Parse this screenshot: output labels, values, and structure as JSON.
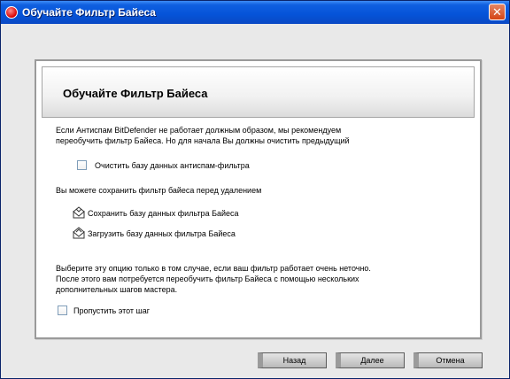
{
  "window": {
    "title": "Обучайте Фильтр Байеса",
    "close_label": "✕"
  },
  "panel": {
    "title": "Обучайте Фильтр Байеса",
    "intro_line1": "Если Антиспам BitDefender не работает должным образом, мы рекомендуем",
    "intro_line2": "переобучить фильтр Байеса. Но для начала Вы должны очистить предыдущий",
    "clear_db_label": "Очистить базу данных антиспам-фильтра",
    "save_note": "Вы можете сохранить фильтр байеса перед удалением",
    "save_action": "Сохранить базу данных фильтра Байеса",
    "load_action": "Загрузить базу данных фильтра Байеса",
    "skip_line1": "Выберите эту опцию только в том случае, если ваш фильтр работает очень неточно.",
    "skip_line2": "После этого вам потребуется переобучить фильтр Байеса с помощью нескольких",
    "skip_line3": "дополнительных шагов мастера.",
    "skip_label": "Пропустить этот шаг"
  },
  "buttons": {
    "back": "Назад",
    "next": "Далее",
    "cancel": "Отмена"
  }
}
